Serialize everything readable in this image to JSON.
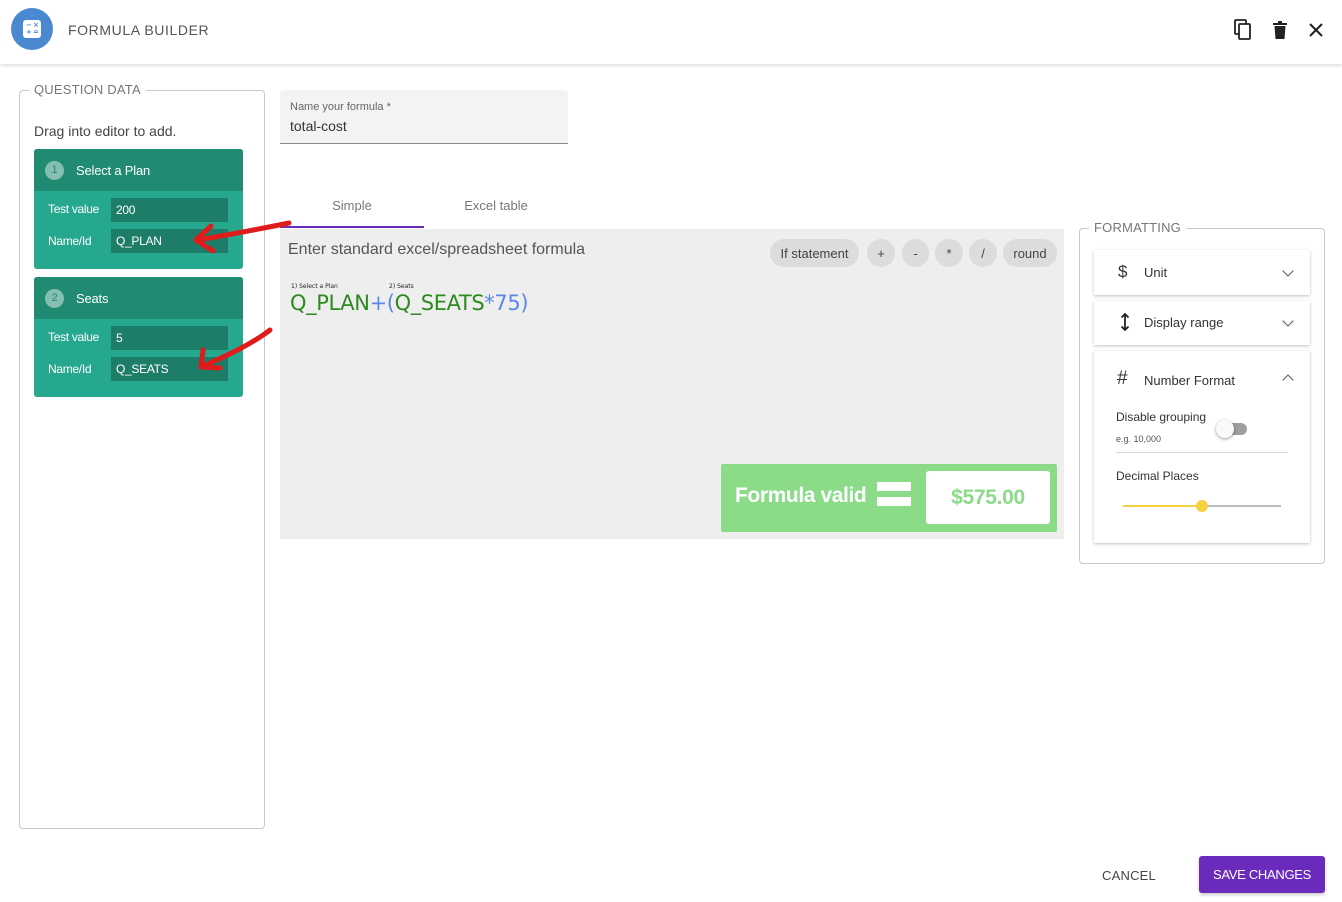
{
  "header": {
    "title": "FORMULA BUILDER",
    "app_icon": "calculator-icon",
    "actions": [
      "copy-icon",
      "delete-icon",
      "close-icon"
    ]
  },
  "question_data": {
    "legend": "QUESTION DATA",
    "hint": "Drag into editor to add.",
    "test_value_label": "Test value",
    "name_label": "Name/Id",
    "cards": [
      {
        "number": "1",
        "title": "Select a Plan",
        "test_value": "200",
        "name_id": "Q_PLAN"
      },
      {
        "number": "2",
        "title": "Seats",
        "test_value": "5",
        "name_id": "Q_SEATS"
      }
    ]
  },
  "formula_name": {
    "label": "Name your formula *",
    "value": "total-cost"
  },
  "tabs": [
    {
      "label": "Simple",
      "active": true
    },
    {
      "label": "Excel table",
      "active": false
    }
  ],
  "editor": {
    "hint": "Enter standard excel/spreadsheet formula",
    "chips": [
      "If statement",
      "+",
      "-",
      "*",
      "/",
      "round"
    ],
    "formula": {
      "label_1": "1) Select a Plan",
      "label_2": "2) Seats",
      "token_1": "Q_PLAN",
      "op_1": "+(",
      "token_2": "Q_SEATS",
      "op_2": "*75)"
    },
    "status": "Formula valid",
    "result": "$575.00"
  },
  "formatting": {
    "legend": "FORMATTING",
    "sections": [
      {
        "icon": "dollar-icon",
        "label": "Unit",
        "expanded": false
      },
      {
        "icon": "vertical-arrows-icon",
        "label": "Display range",
        "expanded": false
      },
      {
        "icon": "hash-icon",
        "label": "Number Format",
        "expanded": true
      }
    ],
    "number_format": {
      "disable_grouping_label": "Disable grouping",
      "disable_grouping_example": "e.g. 10,000",
      "disable_grouping_on": false,
      "decimal_places_label": "Decimal Places",
      "decimal_places_fraction": 0.5
    }
  },
  "footer": {
    "cancel_label": "CANCEL",
    "save_label": "SAVE CHANGES"
  },
  "colors": {
    "accent": "#6a2bbd",
    "card": "#26a88e",
    "card_header": "#218a73",
    "valid_green": "#8bdb88",
    "slider": "#f5d142",
    "annotation_arrow": "#e01b1b"
  }
}
